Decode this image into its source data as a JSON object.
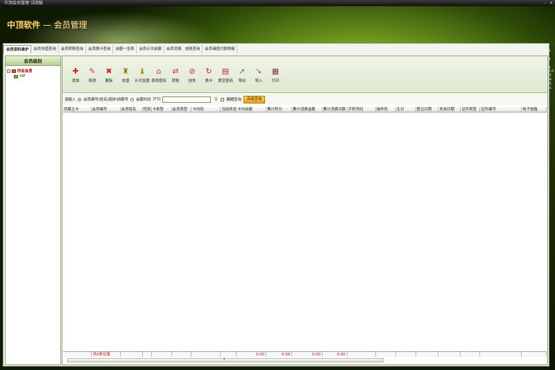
{
  "window": {
    "title": "中顶会员管理 试用版",
    "controls": [
      "-",
      "×"
    ]
  },
  "banner": {
    "brand": "中顶软件",
    "sep": " — ",
    "module": "会员管理"
  },
  "tabs": [
    {
      "label": "会员资料维护",
      "active": true
    },
    {
      "label": "会员充值查询",
      "active": false
    },
    {
      "label": "会员转账查询",
      "active": false
    },
    {
      "label": "会员换卡查询",
      "active": false
    },
    {
      "label": "余额一览表",
      "active": false
    },
    {
      "label": "会员计次余额",
      "active": false
    },
    {
      "label": "会员消费、挂账查询",
      "active": false
    },
    {
      "label": "会员储值付款明细",
      "active": false
    }
  ],
  "sidebar": {
    "title": "会员级别",
    "tree": {
      "root": "所有会员",
      "children": [
        "VIP"
      ]
    }
  },
  "toolbar": {
    "buttons": [
      {
        "label": "添加",
        "icon": "add-icon"
      },
      {
        "label": "修改",
        "icon": "edit-icon"
      },
      {
        "label": "删除",
        "icon": "delete-icon"
      },
      {
        "label": "充值",
        "icon": "recharge-icon"
      },
      {
        "label": "计次设置",
        "icon": "count-setting-icon"
      },
      {
        "label": "修改密码",
        "icon": "change-password-icon"
      },
      {
        "label": "转账",
        "icon": "transfer-icon"
      },
      {
        "label": "挂失",
        "icon": "report-loss-icon"
      },
      {
        "label": "换卡",
        "icon": "change-card-icon"
      },
      {
        "label": "置空密码",
        "icon": "clear-password-icon"
      },
      {
        "label": "导出",
        "icon": "export-icon"
      },
      {
        "label": "导入",
        "icon": "import-icon"
      },
      {
        "label": "打印",
        "icon": "print-icon"
      }
    ]
  },
  "search": {
    "prompt": "请输入",
    "option1": "会员编号\\姓名\\简拼\\档案号",
    "option2": "会籍时间",
    "hint": "[F3]",
    "input_value": "",
    "fuzzy_label": "模糊查询",
    "advanced_label": "高级查询"
  },
  "grid": {
    "columns": [
      "所属主卡",
      "会员编号",
      "会员姓名",
      "性别",
      "卡类型",
      "会员类型",
      "卡内码",
      "当前状态",
      "卡内余额",
      "累计积分",
      "累计消费金额",
      "累计消费次数",
      "手机号码",
      "操作员",
      "生日",
      "登记日期",
      "失效日期",
      "证件类型",
      "证件编号",
      "电子信箱"
    ],
    "rows": []
  },
  "footer": {
    "count_label": "共0条记录",
    "totals": [
      "0.00",
      "0.00",
      "0.00",
      "0.00"
    ]
  },
  "right_edge": {
    "nums": [
      "14.0",
      "8.5",
      "0.4",
      "2.5",
      "1%"
    ]
  },
  "colors": {
    "accent": "#f0a020",
    "danger": "#d00000",
    "panel_border": "#8fa37a"
  }
}
